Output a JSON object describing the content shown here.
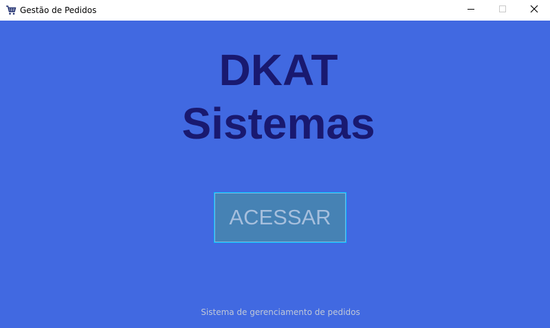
{
  "window": {
    "title": "Gestão de Pedidos",
    "icon": "shopping-cart-icon",
    "controls": {
      "minimize": "minimize-icon",
      "maximize": "maximize-icon",
      "close": "close-icon"
    }
  },
  "main": {
    "heading_line1": "DKAT",
    "heading_line2": "Sistemas",
    "access_button_label": "ACESSAR",
    "footer_text": "Sistema de gerenciamento de pedidos"
  },
  "colors": {
    "background": "#4169e1",
    "heading": "#191970",
    "button_bg": "#4682b4",
    "button_border": "#00bfff",
    "button_text": "#a6bfdd",
    "footer_text": "#c0c8d8"
  }
}
